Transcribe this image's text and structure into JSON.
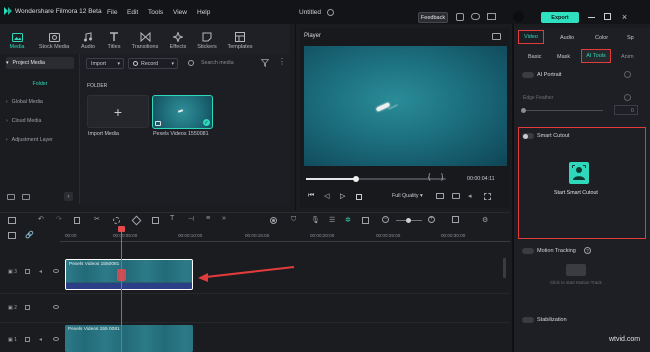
{
  "app": {
    "title": "Wondershare Filmora 12 Beta",
    "menu": [
      "File",
      "Edit",
      "Tools",
      "View",
      "Help"
    ],
    "project_title": "Untitled",
    "feedback_label": "Feedback",
    "export_label": "Export"
  },
  "media_tabs": [
    "Media",
    "Stock Media",
    "Audio",
    "Titles",
    "Transitions",
    "Effects",
    "Stickers",
    "Templates"
  ],
  "sidebar": {
    "project_media": "Project Media",
    "folder": "Folder",
    "items": [
      "Global Media",
      "Cloud Media",
      "Adjustment Layer"
    ]
  },
  "media_toolbar": {
    "import_label": "Import",
    "record_label": "Record",
    "search_placeholder": "Search media"
  },
  "media_main": {
    "folder_heading": "FOLDER",
    "import_media_label": "Import Media",
    "clip_name": "Pexels Videos 1550081"
  },
  "player": {
    "label": "Player",
    "timecode": "00:00:04:11",
    "quality": "Full Quality",
    "progress": 0.36
  },
  "properties": {
    "tabs": [
      "Video",
      "Audio",
      "Color",
      "Sp"
    ],
    "subtabs": [
      "Basic",
      "Mask",
      "AI Tools",
      "Anim"
    ],
    "ai_portrait": "AI Portrait",
    "edge_feather": "Edge Feather",
    "edge_value": "0",
    "smart_cutout": "Smart Cutout",
    "start_smart_cutout": "Start Smart Cutout",
    "motion_tracking": "Motion Tracking",
    "click_motion": "Click to start Motion Track",
    "stabilization": "Stabilization"
  },
  "timeline": {
    "ruler": [
      "00:00",
      "00:00:05:00",
      "00:00:10:00",
      "00:00:15:00",
      "00:00:20:00",
      "00:00:25:00",
      "00:00:30:00"
    ],
    "tracks": [
      {
        "label": "3",
        "clip": "Pexels Videos 1550081"
      },
      {
        "label": "2",
        "clip": ""
      },
      {
        "label": "1",
        "clip": "Pexels Videos 155 0081"
      }
    ]
  },
  "watermark": "wtvid.com",
  "colors": {
    "accent": "#2fd8ba",
    "highlight": "#e23b3b",
    "water": "#1a6d80"
  }
}
